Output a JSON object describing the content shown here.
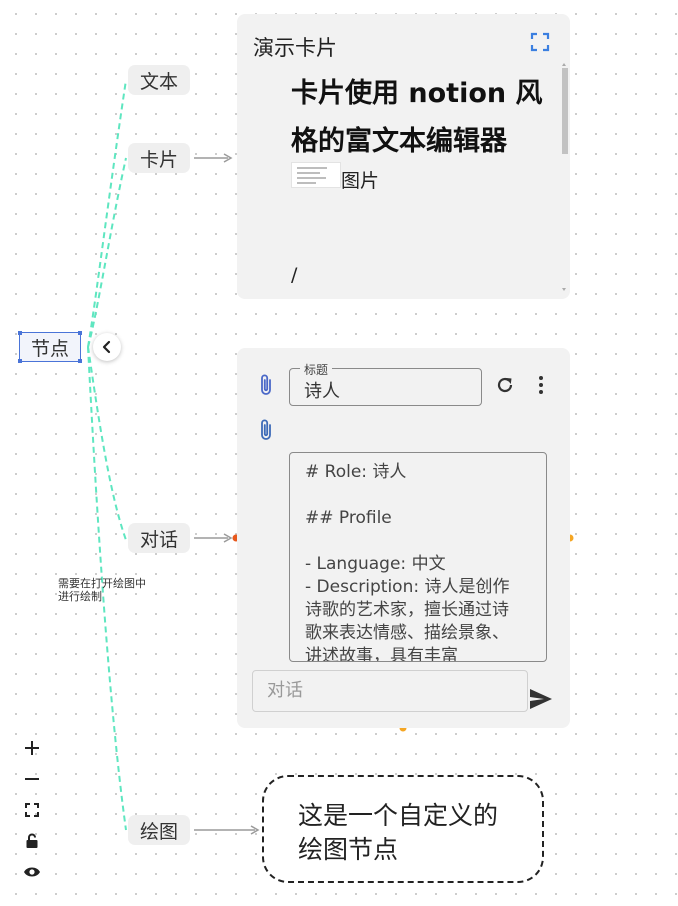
{
  "root_node": {
    "label": "节点"
  },
  "children": [
    {
      "label": "文本"
    },
    {
      "label": "卡片"
    },
    {
      "label": "对话"
    },
    {
      "label": "绘图"
    }
  ],
  "card": {
    "title": "演示卡片",
    "heading": "卡片使用 notion 风格的富文本编辑器",
    "image_label": "图片",
    "slash": "/"
  },
  "chat": {
    "title_label": "标题",
    "title_value": "诗人",
    "prompt": "# Role: 诗人\n\n## Profile\n\n- Language: 中文\n- Description: 诗人是创作诗歌的艺术家，擅长通过诗歌来表达情感、描绘景象、讲述故事，具有丰富",
    "input_placeholder": "对话"
  },
  "draw_node": {
    "text": "这是一个自定义的绘图节点"
  },
  "note": "需要在打开绘图中进行绘制",
  "colors": {
    "edge": "#5ee6c0",
    "selection": "#4a74d8",
    "handle_orange": "#f5a623",
    "handle_red": "#e8581c"
  }
}
